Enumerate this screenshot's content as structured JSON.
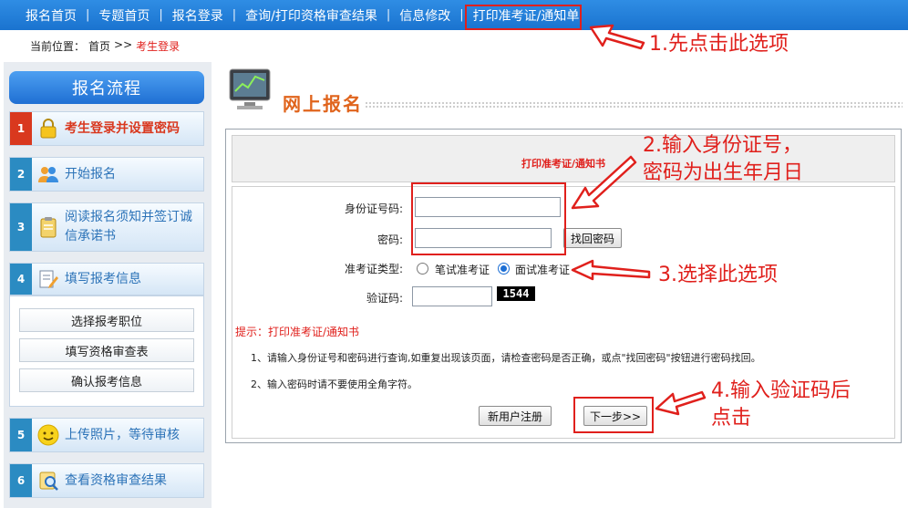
{
  "topnav": {
    "items": [
      "报名首页",
      "专题首页",
      "报名登录",
      "查询/打印资格审查结果",
      "信息修改",
      "打印准考证/通知单"
    ]
  },
  "breadcrumb": {
    "label": "当前位置：",
    "home": "首页",
    "sep": ">>",
    "current": "考生登录"
  },
  "sidebar": {
    "title": "报名流程",
    "steps": [
      {
        "num": "1",
        "label": "考生登录并设置密码"
      },
      {
        "num": "2",
        "label": "开始报名"
      },
      {
        "num": "3",
        "label": "阅读报名须知并签订诚信承诺书"
      },
      {
        "num": "4",
        "label": "填写报考信息"
      },
      {
        "num": "5",
        "label": "上传照片，等待审核"
      },
      {
        "num": "6",
        "label": "查看资格审查结果"
      }
    ],
    "sub_items": [
      "选择报考职位",
      "填写资格审查表",
      "确认报考信息"
    ]
  },
  "heading": "网上报名",
  "form": {
    "header": "打印准考证/通知书",
    "id_label": "身份证号码:",
    "id_value": "",
    "pwd_label": "密码:",
    "pwd_value": "",
    "find_pwd": "找回密码",
    "type_label": "准考证类型:",
    "type_options": [
      "笔试准考证",
      "面试准考证"
    ],
    "type_selected": "面试准考证",
    "captcha_label": "验证码:",
    "captcha_value": "",
    "captcha_code": "1544",
    "register": "新用户注册",
    "next": "下一步>>"
  },
  "tips": {
    "title": "提示：打印准考证/通知书",
    "lines": [
      "1、请输入身份证号和密码进行查询,如重复出现该页面，请检查密码是否正确，或点\"找回密码\"按钮进行密码找回。",
      "2、输入密码时请不要使用全角字符。"
    ]
  },
  "annotations": {
    "note1": "1.先点击此选项",
    "note2_line1": "2.输入身份证号，",
    "note2_line2": "密码为出生年月日",
    "note3": "3.选择此选项",
    "note4_line1": "4.输入验证码后",
    "note4_line2": "点击",
    "color": "#e0201c"
  },
  "colors": {
    "nav_blue": "#1a73cf",
    "accent_red": "#e0201c",
    "heading_orange": "#e0641c"
  }
}
